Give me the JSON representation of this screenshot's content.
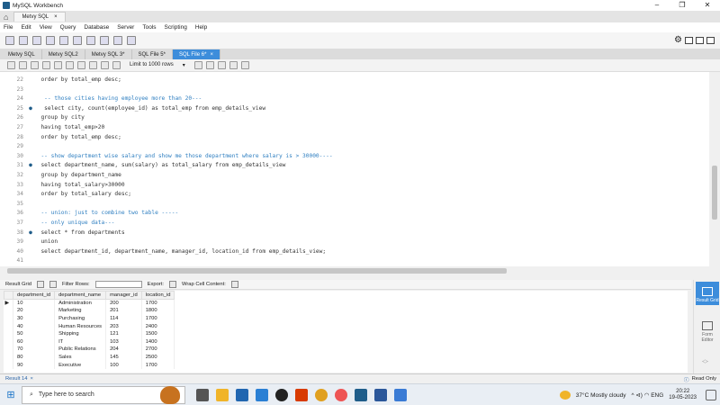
{
  "window": {
    "title": "MySQL Workbench",
    "controls": {
      "minimize": "–",
      "maximize": "❐",
      "close": "✕"
    }
  },
  "connection_tab": {
    "label": "Metvy SQL",
    "close": "×"
  },
  "menu": [
    "File",
    "Edit",
    "View",
    "Query",
    "Database",
    "Server",
    "Tools",
    "Scripting",
    "Help"
  ],
  "editor_tabs": [
    {
      "label": "Metvy SQL",
      "active": false
    },
    {
      "label": "Metvy SQL2",
      "active": false
    },
    {
      "label": "Metvy SQL 3*",
      "active": false
    },
    {
      "label": "SQL File 5*",
      "active": false
    },
    {
      "label": "SQL File 6*",
      "active": true,
      "close": "×"
    }
  ],
  "sql_toolbar": {
    "limit_label": "Limit to 1000 rows",
    "limit_caret": "▾"
  },
  "editor": {
    "lines": [
      {
        "n": "22",
        "dot": "",
        "text": "  order by total_emp desc;",
        "kind": "code"
      },
      {
        "n": "23",
        "dot": "",
        "text": "",
        "kind": "code"
      },
      {
        "n": "24",
        "dot": "",
        "text": "   -- those cities having employee more than 20---",
        "kind": "comment"
      },
      {
        "n": "25",
        "dot": "●",
        "text": "   select city, count(employee_id) as total_emp from emp_details_view",
        "kind": "code"
      },
      {
        "n": "26",
        "dot": "",
        "text": "  group by city",
        "kind": "code"
      },
      {
        "n": "27",
        "dot": "",
        "text": "  having total_emp>20",
        "kind": "code"
      },
      {
        "n": "28",
        "dot": "",
        "text": "  order by total_emp desc;",
        "kind": "code"
      },
      {
        "n": "29",
        "dot": "",
        "text": "",
        "kind": "code"
      },
      {
        "n": "30",
        "dot": "",
        "text": "  -- show department wise salary and show me those department where salary is > 30000----",
        "kind": "comment"
      },
      {
        "n": "31",
        "dot": "●",
        "text": "  select department_name, sum(salary) as total_salary from emp_details_view",
        "kind": "code"
      },
      {
        "n": "32",
        "dot": "",
        "text": "  group by department_name",
        "kind": "code"
      },
      {
        "n": "33",
        "dot": "",
        "text": "  having total_salary>30000",
        "kind": "code"
      },
      {
        "n": "34",
        "dot": "",
        "text": "  order by total_salary desc;",
        "kind": "code"
      },
      {
        "n": "35",
        "dot": "",
        "text": "",
        "kind": "code"
      },
      {
        "n": "36",
        "dot": "",
        "text": "  -- union: just to combine two table -----",
        "kind": "comment"
      },
      {
        "n": "37",
        "dot": "",
        "text": "  -- only unique data---",
        "kind": "comment"
      },
      {
        "n": "38",
        "dot": "●",
        "text": "  select * from departments",
        "kind": "code"
      },
      {
        "n": "39",
        "dot": "",
        "text": "  union",
        "kind": "code"
      },
      {
        "n": "40",
        "dot": "",
        "text": "  select department_id, department_name, manager_id, location_id from emp_details_view;",
        "kind": "code"
      },
      {
        "n": "41",
        "dot": "",
        "text": "",
        "kind": "code"
      }
    ]
  },
  "result_toolbar": {
    "result_grid": "Result Grid",
    "filter_rows": "Filter Rows:",
    "export": "Export:",
    "wrap": "Wrap Cell Content:"
  },
  "result_grid": {
    "columns": [
      "department_id",
      "department_name",
      "manager_id",
      "location_id"
    ],
    "rows": [
      [
        "10",
        "Administration",
        "200",
        "1700"
      ],
      [
        "20",
        "Marketing",
        "201",
        "1800"
      ],
      [
        "30",
        "Purchasing",
        "114",
        "1700"
      ],
      [
        "40",
        "Human Resources",
        "203",
        "2400"
      ],
      [
        "50",
        "Shipping",
        "121",
        "1500"
      ],
      [
        "60",
        "IT",
        "103",
        "1400"
      ],
      [
        "70",
        "Public Relations",
        "204",
        "2700"
      ],
      [
        "80",
        "Sales",
        "145",
        "2500"
      ],
      [
        "90",
        "Executive",
        "100",
        "1700"
      ]
    ],
    "current_row_marker": "▶"
  },
  "right_panel": {
    "result_grid": "Result Grid",
    "form_editor": "Form Editor",
    "arrows": {
      "up": "︿",
      "down": "﹀"
    }
  },
  "status": {
    "result_tab": "Result 14",
    "result_close": "×",
    "read_only": "Read Only",
    "info_icon": "ⓘ"
  },
  "taskbar": {
    "search_placeholder": "Type here to search",
    "weather": "37°C  Mostly cloudy",
    "tray_icons": "^  ⊲)  ◠  ENG",
    "time": "20:22",
    "date": "19-05-2023"
  },
  "colors": {
    "accent": "#3d8ddb",
    "comment": "#2f7fc1",
    "keyword": "#1f3f9a"
  }
}
